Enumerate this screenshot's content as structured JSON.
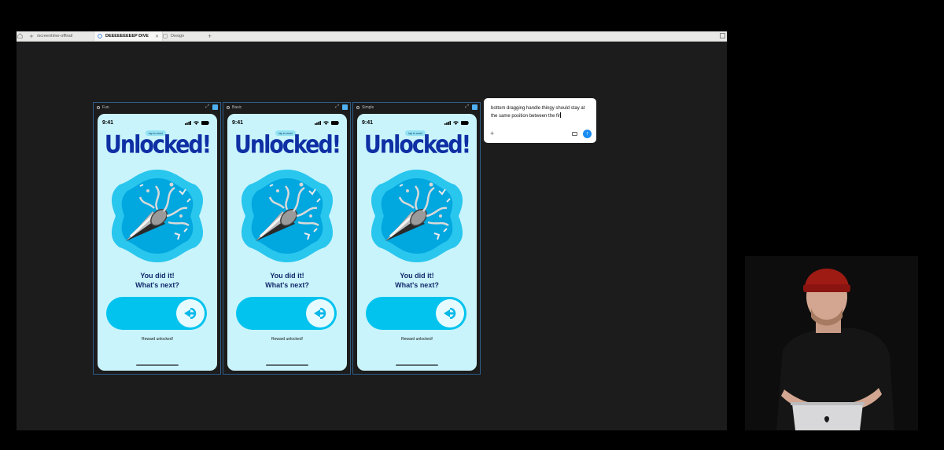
{
  "tabs": [
    {
      "label": "/screentime-offtrail",
      "active": false
    },
    {
      "label": "DEEEEEEEEEP DIVE",
      "active": true
    },
    {
      "label": "Design",
      "active": false
    }
  ],
  "tab_close": "✕",
  "new_tab": "+",
  "frames": [
    {
      "label": "Fun"
    },
    {
      "label": "Basic"
    },
    {
      "label": "Simple"
    }
  ],
  "phone": {
    "time": "9:41",
    "tap_pill": "tap to reset",
    "headline": "Unlocked!",
    "message_line1": "You did it!",
    "message_line2": "What's next?",
    "reward": "Reward unlocked!"
  },
  "comment": {
    "text": "bottom dragging handle thingy should stay at the same position between the fir",
    "add": "+",
    "send": "↑"
  },
  "colors": {
    "phone_bg": "#c9f4fc",
    "headline": "#0f2fa4",
    "slider": "#02c3ee",
    "blob_outer": "#29c6ee",
    "blob_inner": "#01a7df",
    "send_button": "#1a8cf2"
  },
  "icons": [
    "home-icon",
    "frame-icon",
    "expand-icon",
    "component-icon",
    "signal-icon",
    "wifi-icon",
    "battery-icon",
    "image-icon",
    "arrow-icon",
    "party-popper-icon"
  ]
}
